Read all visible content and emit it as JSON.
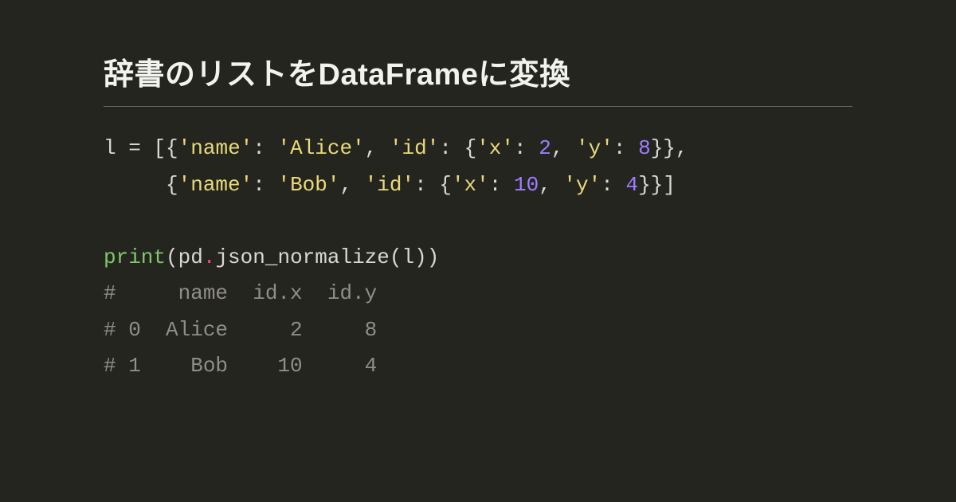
{
  "title": "辞書のリストをDataFrameに変換",
  "tokens": {
    "l": "l ",
    "eq": "= ",
    "ob1": "[{",
    "s_name1": "'name'",
    "colon_sp": ": ",
    "s_alice": "'Alice'",
    "comma_sp": ", ",
    "s_id": "'id'",
    "ob2": "{",
    "s_x": "'x'",
    "n2": "2",
    "s_y": "'y'",
    "n8": "8",
    "cb2": "}}",
    "comma": ",",
    "indent2": "     {",
    "s_bob": "'Bob'",
    "n10": "10",
    "n4": "4",
    "cb3": "}}]",
    "print": "print",
    "paren_o": "(",
    "pd": "pd",
    "dot": ".",
    "jn": "json_normalize",
    "lvar": "(l)",
    "paren_c": ")"
  },
  "output": {
    "c1": "#     name  id.x  id.y",
    "c2": "# 0  Alice     2     8",
    "c3": "# 1    Bob    10     4"
  }
}
